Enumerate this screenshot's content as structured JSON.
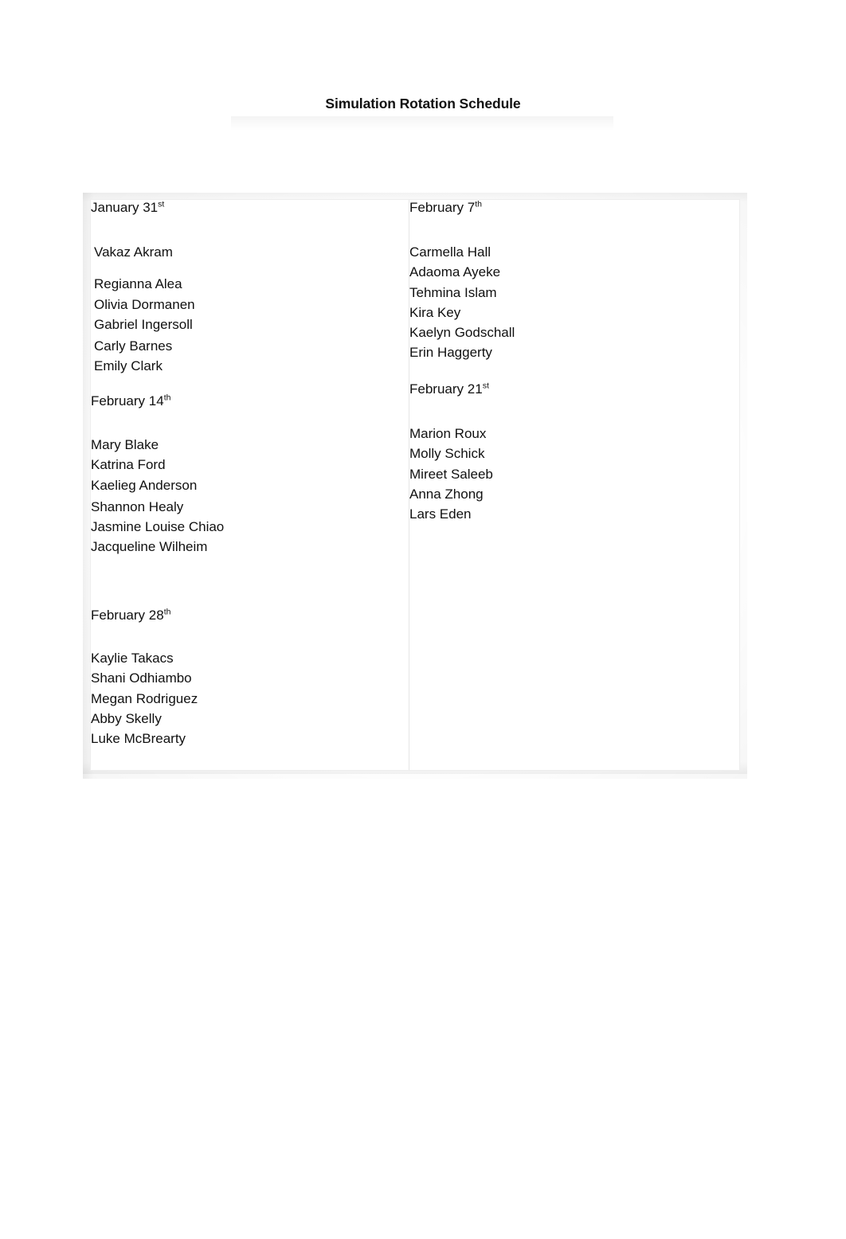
{
  "document": {
    "title": "Simulation Rotation Schedule"
  },
  "schedule": {
    "left_column": [
      {
        "date_month": "January",
        "date_day": "31",
        "date_suffix": "st",
        "lead_name": "Vakaz Akram",
        "names": [
          "Regianna Alea",
          "Olivia Dormanen",
          "Gabriel Ingersoll",
          "Carly Barnes",
          "Emily Clark"
        ]
      },
      {
        "date_month": "February",
        "date_day": "14",
        "date_suffix": "th",
        "lead_name": "",
        "names": [
          "Mary Blake",
          "Katrina Ford",
          "Kaelieg Anderson",
          "Shannon Healy",
          "Jasmine Louise Chiao",
          "Jacqueline Wilheim"
        ]
      },
      {
        "date_month": "February",
        "date_day": "28",
        "date_suffix": "th",
        "lead_name": "",
        "names": [
          "Kaylie Takacs",
          "Shani Odhiambo",
          "Megan Rodriguez",
          "Abby Skelly",
          "Luke McBrearty"
        ]
      }
    ],
    "right_column": [
      {
        "date_month": "February",
        "date_day": "7",
        "date_suffix": "th",
        "lead_name": "",
        "names": [
          "Carmella Hall",
          "Adaoma Ayeke",
          "Tehmina Islam",
          "Kira Key",
          "Kaelyn Godschall",
          "Erin Haggerty"
        ]
      },
      {
        "date_month": "February",
        "date_day": "21",
        "date_suffix": "st",
        "lead_name": "",
        "names": [
          "Marion Roux",
          "Molly Schick",
          "Mireet Saleeb",
          "Anna Zhong",
          "Lars Eden"
        ]
      }
    ]
  }
}
